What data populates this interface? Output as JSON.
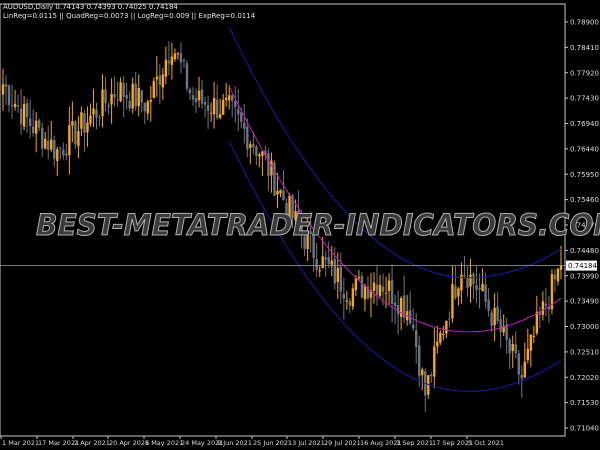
{
  "header": {
    "symbol_line": "AUDUSD,Daily  0.74143 0.74393 0.74025 0.74184",
    "reg_line": "LinReg=0.0115 || QuadReg=0.0073 || LogReg=0.009 || ExpReg=0.0114"
  },
  "watermark": "BEST-METATRADER-INDICATORS.COM",
  "colors": {
    "up": "#f5a623",
    "down": "#6b7785",
    "upper_band": "#1c1ca8",
    "mid_line": "#c020c0",
    "lower_band": "#1c1ca8",
    "grid_axis": "#c8c8c8",
    "price_line": "#a0a0a0"
  },
  "chart_data": {
    "type": "candlestick",
    "symbol": "AUDUSD",
    "timeframe": "Daily",
    "current_price": 0.74184,
    "current_price_label": "0.74184",
    "ylim": [
      0.7075,
      0.7916
    ],
    "y_ticks": [
      "0.78900",
      "0.78410",
      "0.77920",
      "0.77430",
      "0.76940",
      "0.76440",
      "0.75950",
      "0.75460",
      "0.74970",
      "0.74480",
      "0.73990",
      "0.73490",
      "0.73000",
      "0.72510",
      "0.72020",
      "0.71530",
      "0.71040"
    ],
    "x_ticks": [
      "1 Mar 2021",
      "17 Mar 2021",
      "2 Apr 2021",
      "20 Apr 2021",
      "6 May 2021",
      "24 May 2021",
      "9 Jun 2021",
      "25 Jun 2021",
      "13 Jul 2021",
      "29 Jul 2021",
      "16 Aug 2021",
      "1 Sep 2021",
      "17 Sep 2021",
      "5 Oct 2021"
    ],
    "close_keypoints": [
      [
        0,
        0.777
      ],
      [
        8,
        0.77
      ],
      [
        18,
        0.764
      ],
      [
        28,
        0.77
      ],
      [
        38,
        0.776
      ],
      [
        48,
        0.773
      ],
      [
        56,
        0.785
      ],
      [
        63,
        0.774
      ],
      [
        75,
        0.772
      ],
      [
        85,
        0.764
      ],
      [
        92,
        0.756
      ],
      [
        98,
        0.749
      ],
      [
        105,
        0.743
      ],
      [
        115,
        0.737
      ],
      [
        125,
        0.739
      ],
      [
        135,
        0.733
      ],
      [
        140,
        0.717
      ],
      [
        145,
        0.728
      ],
      [
        152,
        0.742
      ],
      [
        158,
        0.737
      ],
      [
        165,
        0.729
      ],
      [
        172,
        0.72
      ],
      [
        177,
        0.73
      ],
      [
        185,
        0.7418
      ]
    ],
    "regression_channel": {
      "start_bar": 75,
      "end_bar": 185,
      "upper": [
        0.788,
        0.7395,
        0.745
      ],
      "middle": [
        0.7765,
        0.729,
        0.7355
      ],
      "lower": [
        0.766,
        0.7175,
        0.7235
      ]
    }
  }
}
